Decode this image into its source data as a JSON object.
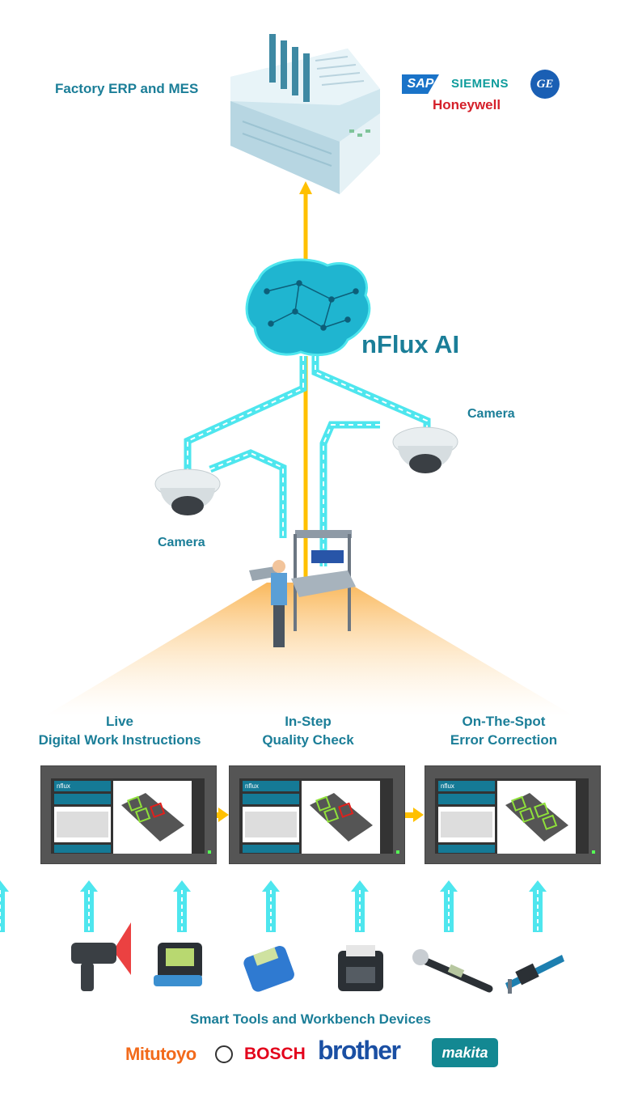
{
  "top": {
    "erp_label": "Factory ERP and MES",
    "erp_logos": [
      "SAP",
      "SIEMENS",
      "GE",
      "Honeywell"
    ]
  },
  "ai": {
    "label": "nFlux AI"
  },
  "cameras": [
    {
      "label": "Camera"
    },
    {
      "label": "Camera"
    }
  ],
  "stages": [
    {
      "line1": "Live",
      "line2": "Digital Work Instructions",
      "screen_brand": "nflux"
    },
    {
      "line1": "In-Step",
      "line2": "Quality Check",
      "screen_brand": "nflux"
    },
    {
      "line1": "On-The-Spot",
      "line2": "Error Correction",
      "screen_brand": "nflux"
    }
  ],
  "devices": {
    "label": "Smart Tools and Workbench Devices",
    "items": [
      "barcode-scanner",
      "handheld-terminal",
      "measurement-meter",
      "label-printer",
      "torque-wrench",
      "digital-caliper"
    ],
    "logos": [
      "Mitutoyo",
      "BOSCH",
      "brother",
      "makita"
    ]
  },
  "colors": {
    "teal_text": "#1b7e98",
    "flow_arrow": "#ffc000",
    "data_path": "#4ee6ee",
    "screen_header": "#157a96",
    "error_box": "#e0201c",
    "ok_box": "#8fe03a"
  }
}
